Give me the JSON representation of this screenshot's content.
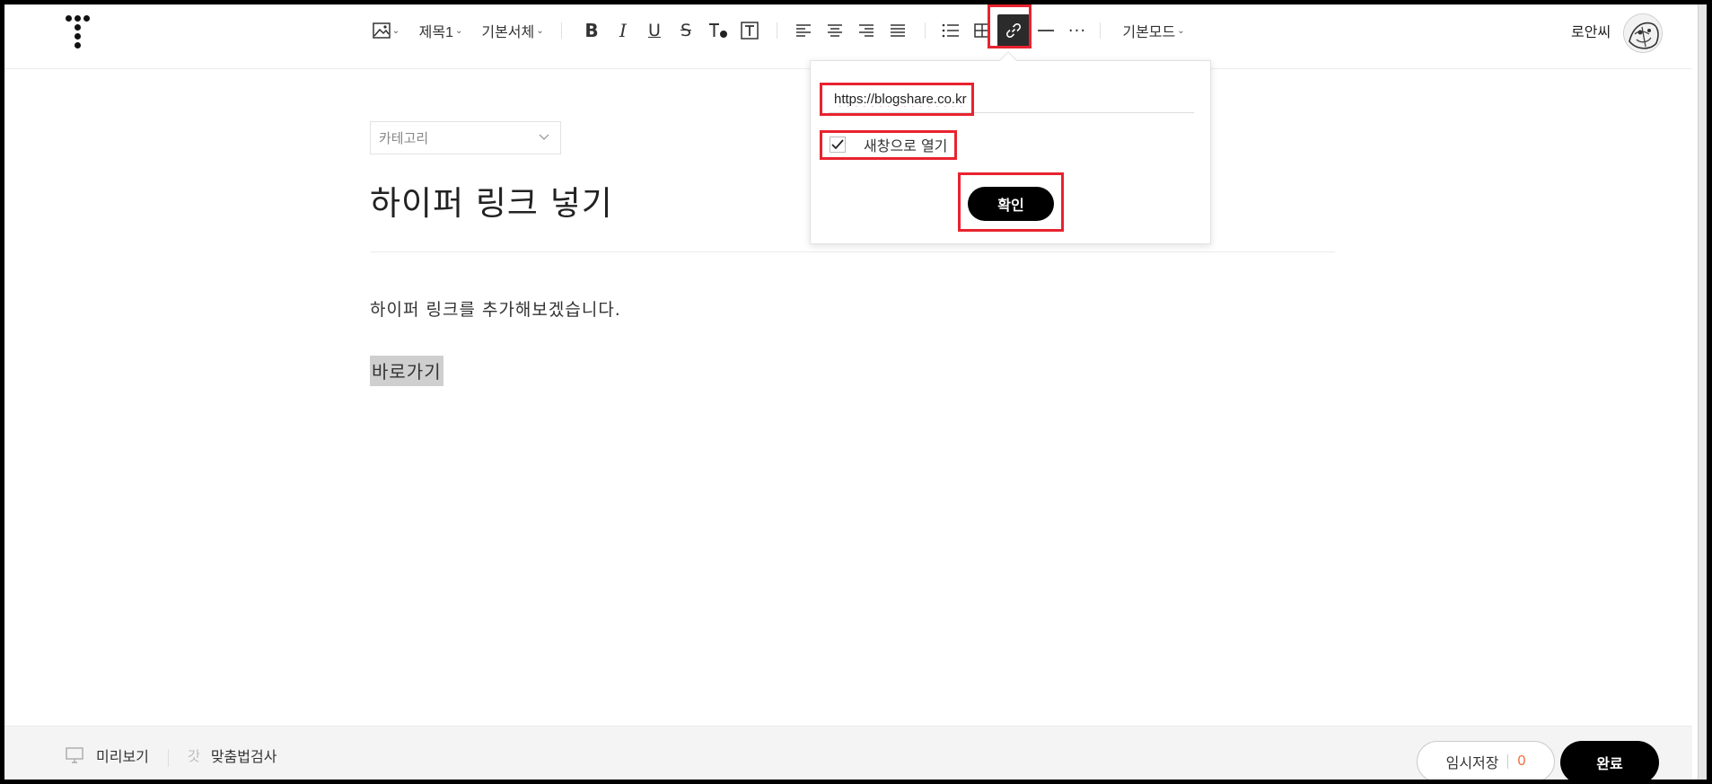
{
  "header": {
    "logo_icon": "tistory-logo-icon",
    "toolbar": {
      "image_icon": "image-icon",
      "heading_label": "제목1",
      "font_label": "기본서체",
      "bold_icon": "bold-icon",
      "italic_icon": "italic-icon",
      "underline_icon": "underline-icon",
      "strike_icon": "strikethrough-icon",
      "text_color_icon": "text-color-icon",
      "text_bg_icon": "text-background-icon",
      "align_icons": [
        "align-left-icon",
        "align-center-icon",
        "align-right-icon",
        "align-justify-icon"
      ],
      "list_icon": "list-icon",
      "table_icon": "table-icon",
      "link_icon": "link-icon",
      "hr_icon": "horizontal-line-icon",
      "more_label": "···",
      "mode_label": "기본모드"
    },
    "user_name": "로안씨"
  },
  "link_popup": {
    "url_value": "https://blogshare.co.kr",
    "new_window_label": "새창으로 열기",
    "new_window_checked": true,
    "confirm_label": "확인"
  },
  "editor": {
    "category_placeholder": "카테고리",
    "title": "하이퍼 링크 넣기",
    "paragraph": "하이퍼 링크를 추가해보겠습니다.",
    "selected_text": "바로가기"
  },
  "footer": {
    "preview_label": "미리보기",
    "spellcheck_label": "맞춤법검사",
    "save_label": "임시저장",
    "save_count": "0",
    "done_label": "완료"
  },
  "colors": {
    "highlight_red": "#e8232f",
    "save_count": "#f26b3a",
    "primary_button": "#000000"
  }
}
